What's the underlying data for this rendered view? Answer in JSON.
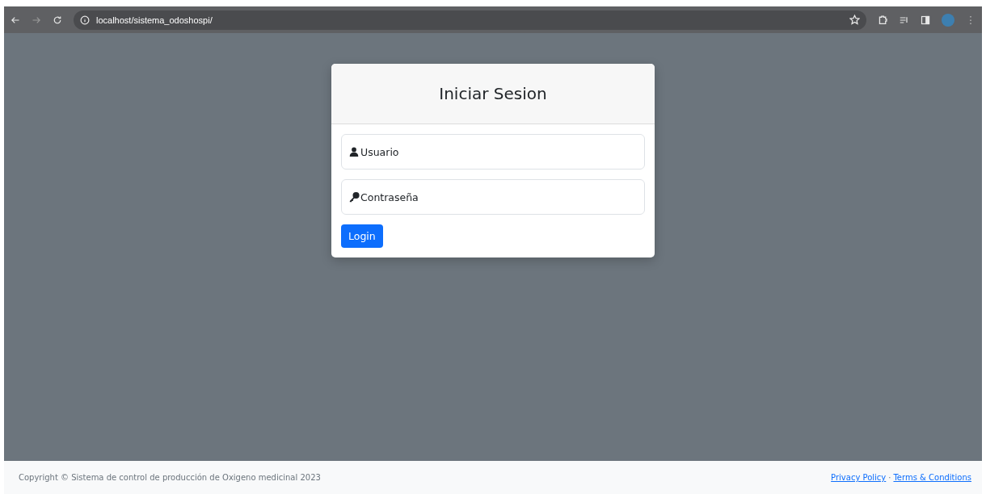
{
  "browser": {
    "url": "localhost/sistema_odoshospi/"
  },
  "login_card": {
    "title": "Iniciar Sesion",
    "fields": [
      {
        "kind": "user",
        "placeholder": "Usuario"
      },
      {
        "kind": "password",
        "placeholder": "Contraseña"
      }
    ],
    "button": "Login"
  },
  "footer": {
    "copyright": "Copyright © Sistema de control de producción de Oxigeno medicinal 2023",
    "links": [
      "Privacy Policy",
      "Terms & Conditions"
    ],
    "separator": "·"
  }
}
